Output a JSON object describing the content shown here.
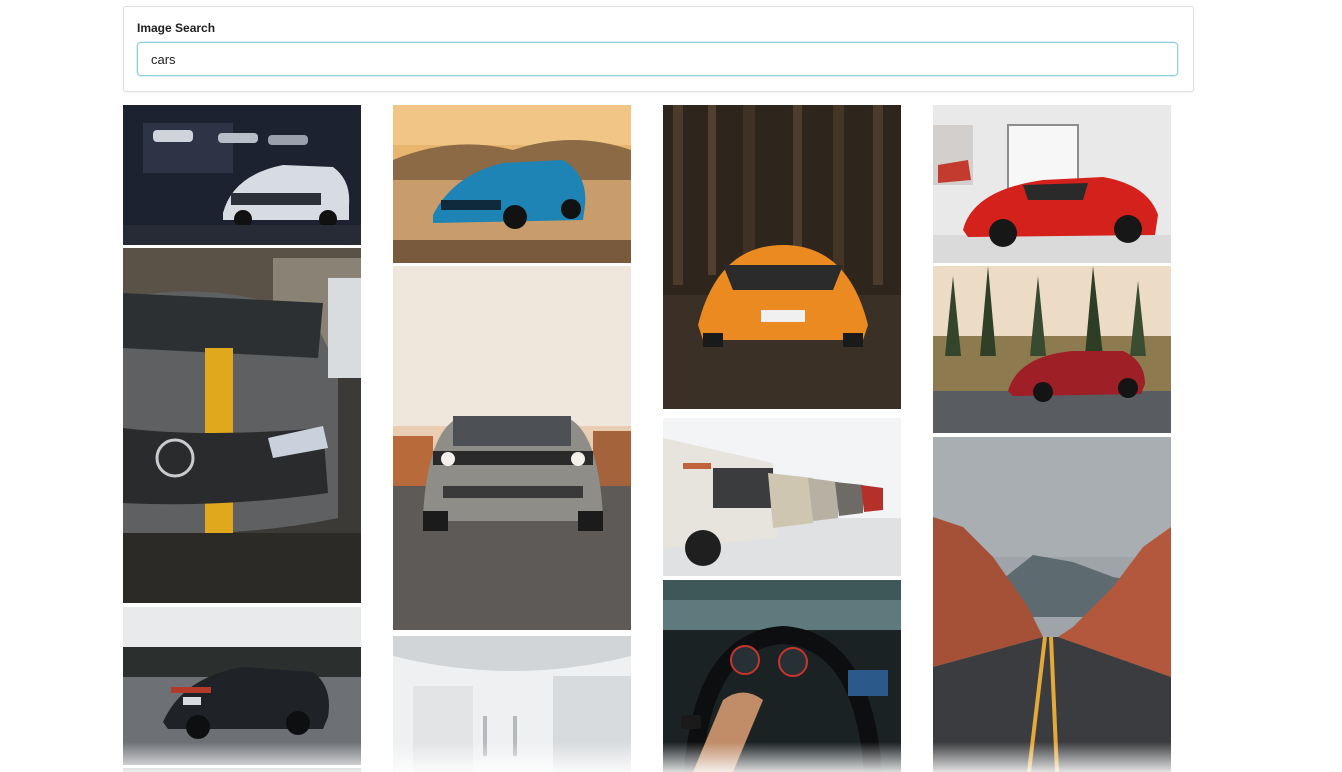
{
  "search": {
    "label": "Image Search",
    "value": "cars"
  },
  "results": {
    "columns": [
      [
        "camaro-garage-photo",
        "mercedes-yellow-stripe-photo",
        "porsche-road-photo",
        "car-partial-photo"
      ],
      [
        "blue-camaro-sand-photo",
        "challenger-sunset-photo",
        "white-interior-photo"
      ],
      [
        "orange-lamborghini-forest-photo",
        "classic-bmw-row-photo",
        "audi-steering-wheel-photo"
      ],
      [
        "red-ferrari-showroom-photo",
        "red-amg-forest-photo",
        "desert-road-photo"
      ]
    ]
  },
  "colors": {
    "input_border": "#8fd0df",
    "card_border": "#dcdfe3"
  }
}
